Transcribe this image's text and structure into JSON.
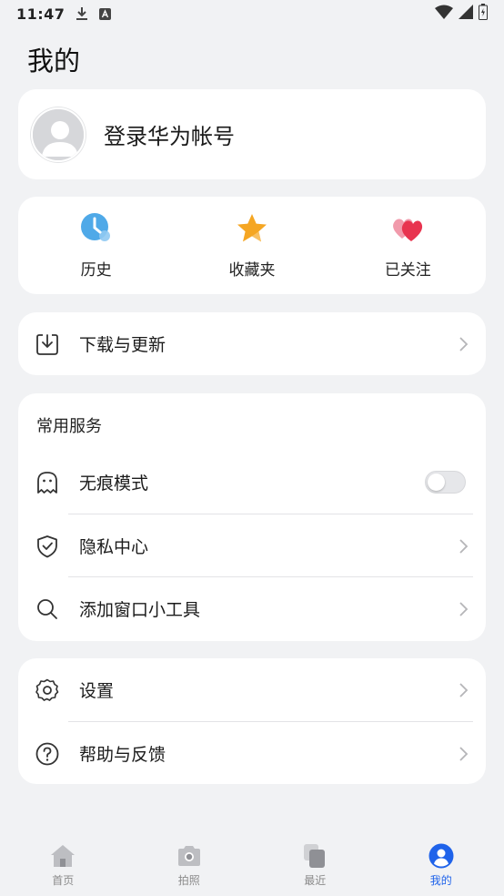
{
  "status_bar": {
    "time": "11:47",
    "icons": [
      "download-icon",
      "a-badge-icon",
      "wifi-icon",
      "signal-icon",
      "battery-icon"
    ]
  },
  "page": {
    "title": "我的"
  },
  "account": {
    "login_text": "登录华为帐号"
  },
  "quick_access": [
    {
      "label": "历史",
      "icon": "history-clock-icon",
      "color": "#4fa9e8"
    },
    {
      "label": "收藏夹",
      "icon": "favorites-star-icon",
      "color": "#f5a623"
    },
    {
      "label": "已关注",
      "icon": "followed-hearts-icon",
      "color": "#e8344f"
    }
  ],
  "download": {
    "label": "下载与更新"
  },
  "services": {
    "title": "常用服务",
    "items": [
      {
        "label": "无痕模式",
        "control": "toggle",
        "toggle_on": false
      },
      {
        "label": "隐私中心",
        "control": "chevron"
      },
      {
        "label": "添加窗口小工具",
        "control": "chevron"
      }
    ]
  },
  "settings": {
    "items": [
      {
        "label": "设置"
      },
      {
        "label": "帮助与反馈"
      }
    ]
  },
  "bottom_nav": {
    "items": [
      {
        "label": "首页",
        "active": false
      },
      {
        "label": "拍照",
        "active": false
      },
      {
        "label": "最近",
        "active": false
      },
      {
        "label": "我的",
        "active": true
      }
    ],
    "active_color": "#1f63ea",
    "inactive_color": "#8a8a8a"
  }
}
